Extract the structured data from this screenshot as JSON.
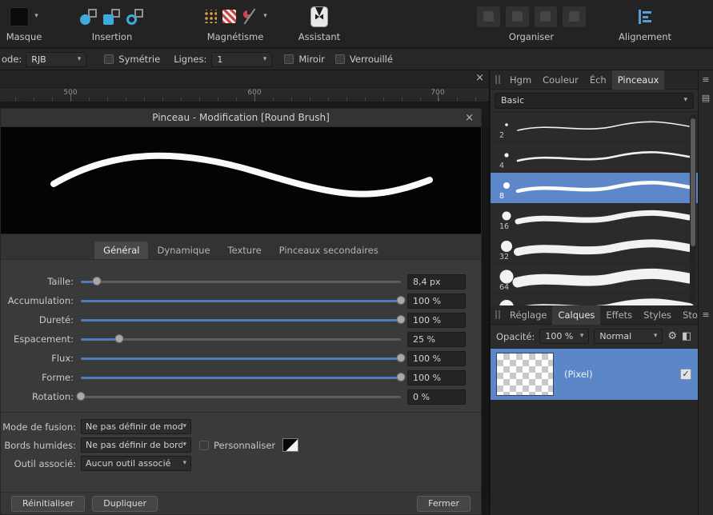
{
  "icons": {
    "caret_down": "▾",
    "close": "×",
    "menu": "≡",
    "list_view": "▤",
    "gear": "⚙",
    "check": "✓",
    "blend_ranges": "◧"
  },
  "toolbar": {
    "masque_label": "Masque",
    "insertion_label": "Insertion",
    "magnetisme_label": "Magnétisme",
    "assistant_label": "Assistant",
    "organiser_label": "Organiser",
    "alignement_label": "Alignement"
  },
  "context_bar": {
    "mode_label": "ode:",
    "mode_value": "RJB",
    "symetrie_label": "Symétrie",
    "lignes_label": "Lignes:",
    "lignes_value": "1",
    "miroir_label": "Miroir",
    "verrouille_label": "Verrouillé"
  },
  "canvas": {
    "ruler_ticks": [
      {
        "label": "500"
      },
      {
        "label": "600"
      },
      {
        "label": "700"
      }
    ]
  },
  "dialog": {
    "title": "Pinceau - Modification [Round Brush]",
    "tabs": [
      {
        "label": "Général"
      },
      {
        "label": "Dynamique"
      },
      {
        "label": "Texture"
      },
      {
        "label": "Pinceaux secondaires"
      }
    ],
    "active_tab": "Général",
    "sliders": [
      {
        "label": "Taille:",
        "value": "8,4 px",
        "pct": 5
      },
      {
        "label": "Accumulation:",
        "value": "100 %",
        "pct": 100
      },
      {
        "label": "Dureté:",
        "value": "100 %",
        "pct": 100
      },
      {
        "label": "Espacement:",
        "value": "25 %",
        "pct": 12
      },
      {
        "label": "Flux:",
        "value": "100 %",
        "pct": 100
      },
      {
        "label": "Forme:",
        "value": "100 %",
        "pct": 100
      },
      {
        "label": "Rotation:",
        "value": "0 %",
        "pct": 0
      }
    ],
    "selects": [
      {
        "label": "Mode de fusion:",
        "value": "Ne pas définir de mode d"
      },
      {
        "label": "Bords humides:",
        "value": "Ne pas définir de bords h"
      },
      {
        "label": "Outil associé:",
        "value": "Aucun outil associé"
      }
    ],
    "personnaliser_label": "Personnaliser",
    "buttons": {
      "reset": "Réinitialiser",
      "duplicate": "Dupliquer",
      "close": "Fermer"
    }
  },
  "brushes_panel": {
    "tabs": [
      {
        "label": "Hgm"
      },
      {
        "label": "Couleur"
      },
      {
        "label": "Éch"
      },
      {
        "label": "Pinceaux"
      }
    ],
    "active_tab": "Pinceaux",
    "category_value": "Basic",
    "brushes": [
      {
        "size": "2",
        "r": 1.8,
        "stroke_w": 1.6
      },
      {
        "size": "4",
        "r": 2.6,
        "stroke_w": 2.6
      },
      {
        "size": "8",
        "r": 4,
        "stroke_w": 4.5,
        "selected": true
      },
      {
        "size": "16",
        "r": 5.5,
        "stroke_w": 7
      },
      {
        "size": "32",
        "r": 7,
        "stroke_w": 10
      },
      {
        "size": "64",
        "r": 8.5,
        "stroke_w": 13
      },
      {
        "size": "",
        "r": 9,
        "stroke_w": 14
      }
    ]
  },
  "layers_panel": {
    "tabs": [
      {
        "label": "Réglage"
      },
      {
        "label": "Calques"
      },
      {
        "label": "Effets"
      },
      {
        "label": "Styles"
      },
      {
        "label": "Stock"
      }
    ],
    "active_tab": "Calques",
    "opacity_label": "Opacité:",
    "opacity_value": "100 %",
    "blend_value": "Normal",
    "layer": {
      "label": "(Pixel)",
      "checked": true
    }
  },
  "colors": {
    "selection_blue": "#5d87c9",
    "slider_blue": "#4d7dbf",
    "insertion_icon_blue": "#3fa9e0",
    "magnet_red": "#cf4747"
  }
}
